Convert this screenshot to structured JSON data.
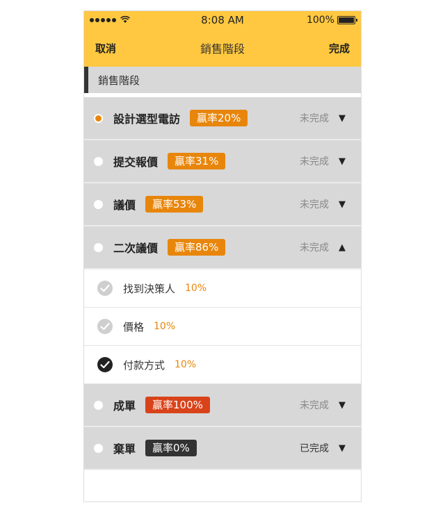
{
  "status_bar": {
    "time": "8:08 AM",
    "battery": "100%",
    "signal_dots": 5,
    "battery_level": 1.0
  },
  "nav": {
    "cancel": "取消",
    "title": "銷售階段",
    "done": "完成"
  },
  "section_title": "銷售階段",
  "colors": {
    "accent": "#ffc840",
    "orange": "#e8860c",
    "red": "#d9431a",
    "dark": "#333333"
  },
  "stages": [
    {
      "name": "設計選型電訪",
      "badge": "贏率20%",
      "status": "未完成",
      "caret": "▼",
      "active": true
    },
    {
      "name": "提交報價",
      "badge": "贏率31%",
      "status": "未完成",
      "caret": "▼"
    },
    {
      "name": "議價",
      "badge": "贏率53%",
      "status": "未完成",
      "caret": "▼"
    },
    {
      "name": "二次議價",
      "badge": "贏率86%",
      "status": "未完成",
      "caret": "▲"
    },
    {
      "name": "成單",
      "badge": "贏率100%",
      "status": "未完成",
      "caret": "▼"
    },
    {
      "name": "棄單",
      "badge": "贏率0%",
      "status": "已完成",
      "caret": "▼"
    }
  ],
  "substeps": [
    {
      "name": "找到決策人",
      "pct": "10%",
      "checked": false
    },
    {
      "name": "價格",
      "pct": "10%",
      "checked": false
    },
    {
      "name": "付款方式",
      "pct": "10%",
      "checked": true
    }
  ]
}
